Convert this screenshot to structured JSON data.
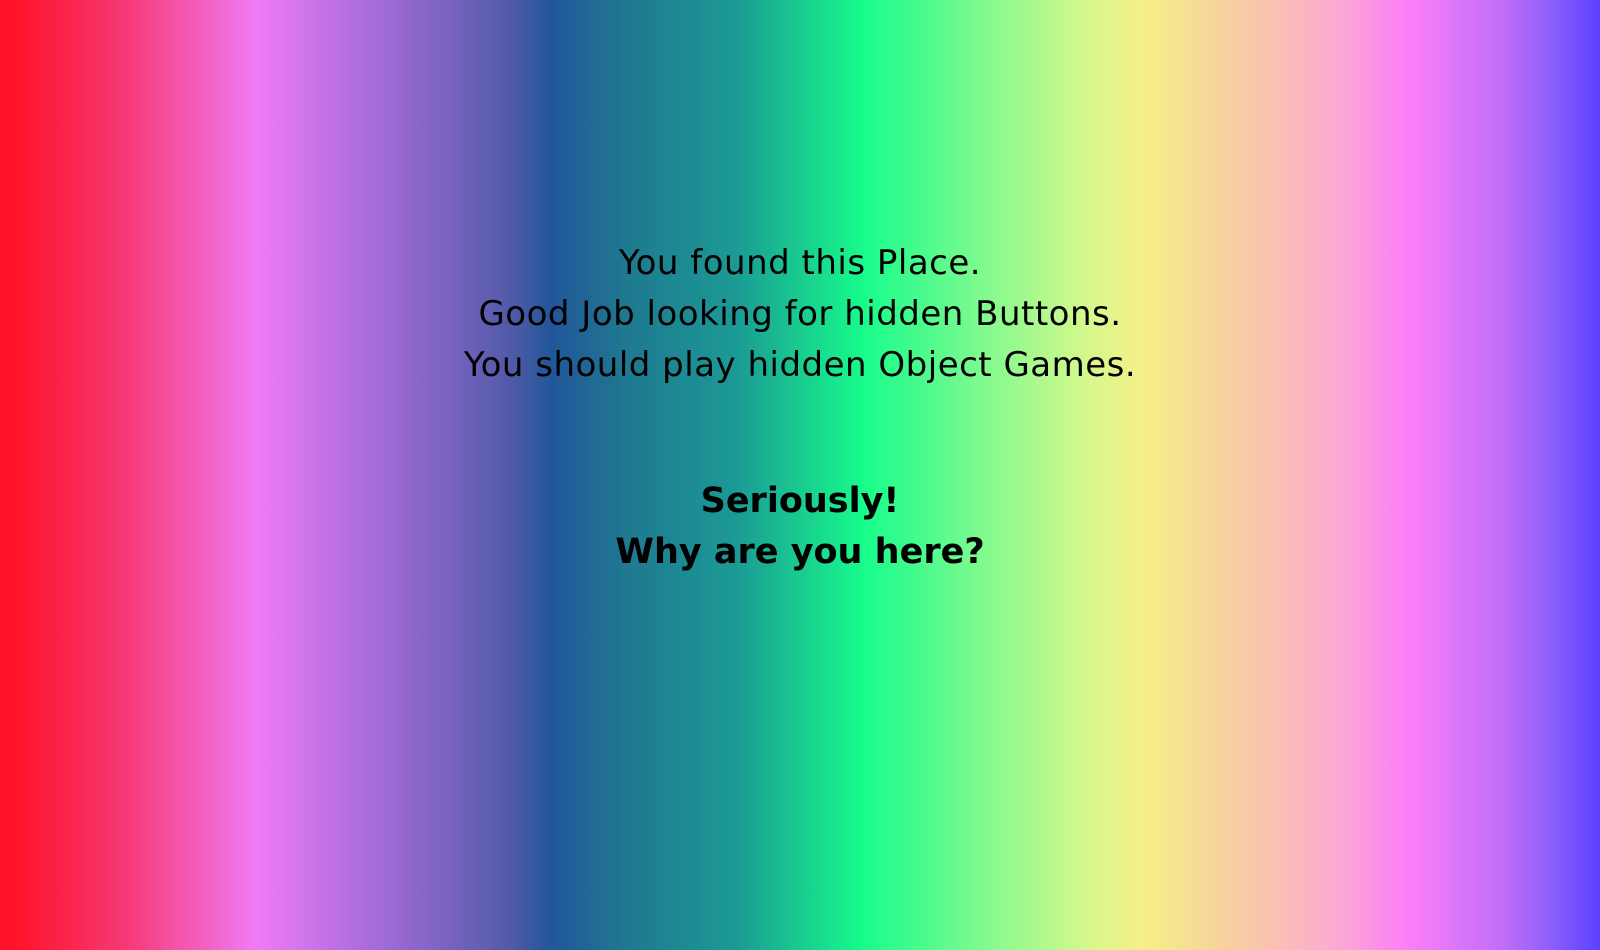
{
  "message": {
    "line1": "You found this Place.",
    "line2": "Good Job looking for hidden Buttons.",
    "line3": "You should play hidden Object Games."
  },
  "emphasis": {
    "line1": "Seriously!",
    "line2": "Why are you here?"
  },
  "colors": {
    "text": "#000000",
    "gradient_stops": [
      "#ff1328",
      "#f07bf5",
      "#21569a",
      "#17fc8b",
      "#f6ef88",
      "#fc7ff8",
      "#5a40ff"
    ]
  }
}
